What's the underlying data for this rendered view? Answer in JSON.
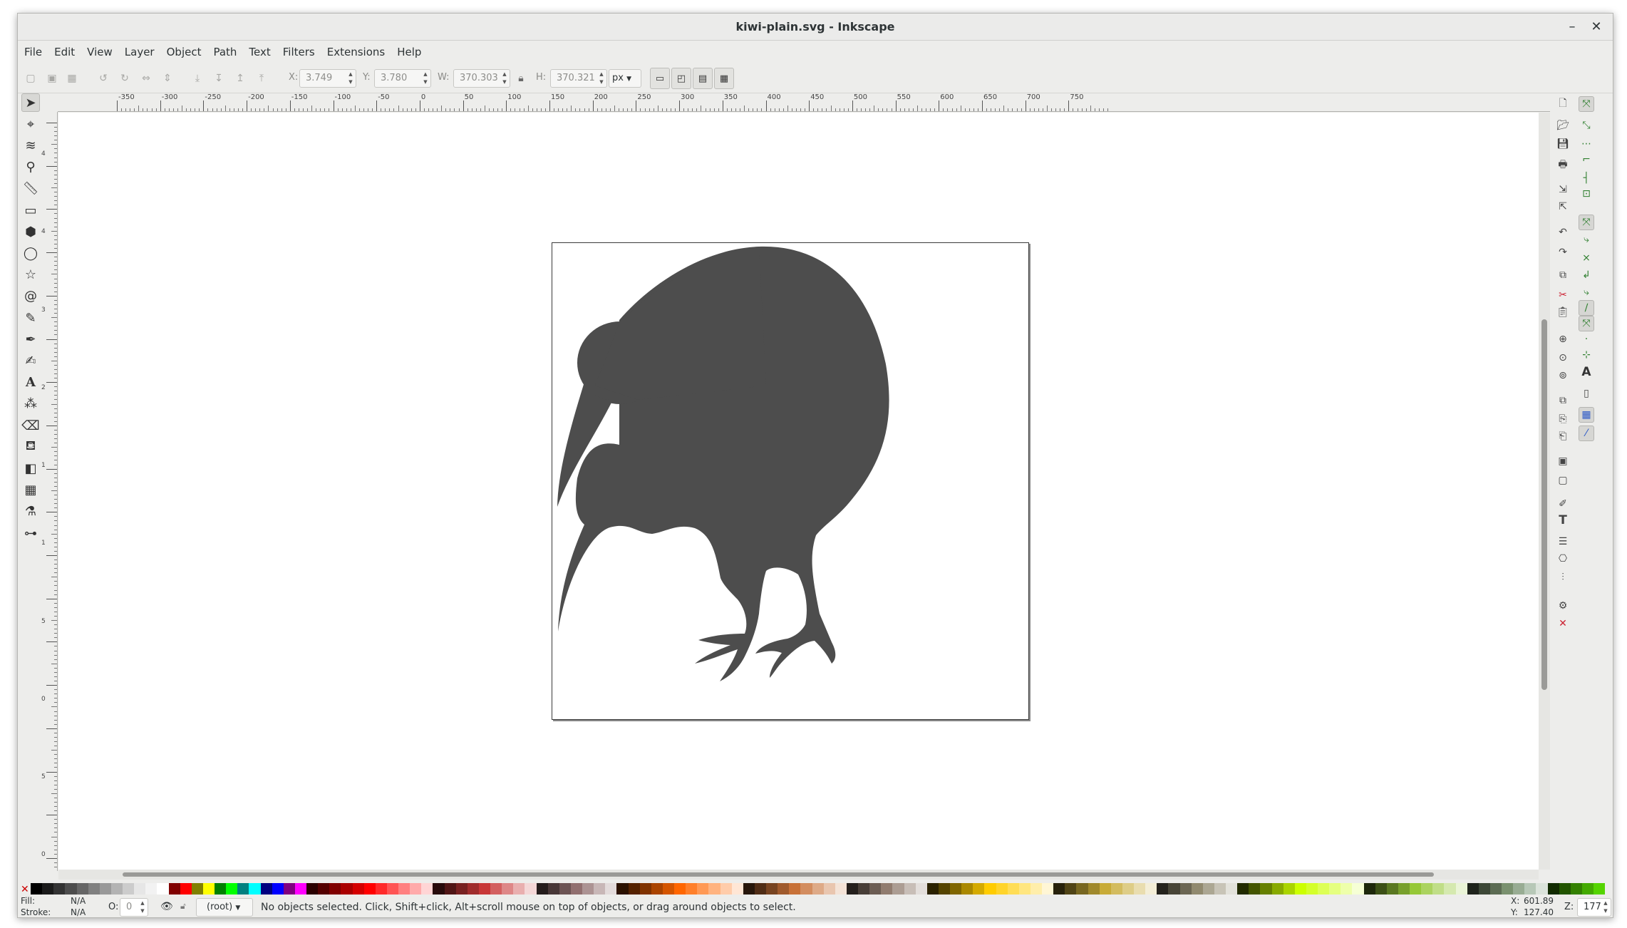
{
  "window": {
    "title": "kiwi-plain.svg - Inkscape",
    "minimize_glyph": "–",
    "close_glyph": "✕"
  },
  "menu": [
    "File",
    "Edit",
    "View",
    "Layer",
    "Object",
    "Path",
    "Text",
    "Filters",
    "Extensions",
    "Help"
  ],
  "tool_controls": {
    "x_label": "X:",
    "x_value": "3.749",
    "y_label": "Y:",
    "y_value": "3.780",
    "w_label": "W:",
    "w_value": "370.303",
    "h_label": "H:",
    "h_value": "370.321",
    "unit": "px"
  },
  "ruler": {
    "h_labels": [
      "-350",
      "-300",
      "-250",
      "-200",
      "-150",
      "-100",
      "-50",
      "0",
      "50",
      "100",
      "150",
      "200",
      "250",
      "300",
      "350",
      "400",
      "450",
      "500",
      "550",
      "600",
      "650",
      "700",
      "750"
    ],
    "v_labels": [
      "4",
      "4",
      "3",
      "2",
      "1",
      "1",
      "5",
      "0",
      "5",
      "0"
    ]
  },
  "toolbox": [
    "selector-tool-icon",
    "node-tool-icon",
    "tweak-tool-icon",
    "zoom-tool-icon",
    "measure-tool-icon",
    "rectangle-tool-icon",
    "3dbox-tool-icon",
    "ellipse-tool-icon",
    "star-tool-icon",
    "spiral-tool-icon",
    "pencil-tool-icon",
    "pen-tool-icon",
    "calligraphy-tool-icon",
    "text-tool-icon",
    "spray-tool-icon",
    "eraser-tool-icon",
    "paint-bucket-tool-icon",
    "gradient-tool-icon",
    "mesh-tool-icon",
    "dropper-tool-icon",
    "connector-tool-icon"
  ],
  "drawing": {
    "fill": "#4d4d4d",
    "page_border": "#3a3a3a"
  },
  "palette_colors": [
    "#000000",
    "#1a1a1a",
    "#333333",
    "#4d4d4d",
    "#666666",
    "#808080",
    "#999999",
    "#b3b3b3",
    "#cccccc",
    "#e6e6e6",
    "#f2f2f2",
    "#ffffff",
    "#800000",
    "#ff0000",
    "#808000",
    "#ffff00",
    "#008000",
    "#00ff00",
    "#008080",
    "#00ffff",
    "#000080",
    "#0000ff",
    "#800080",
    "#ff00ff",
    "#2b0000",
    "#550000",
    "#800000",
    "#aa0000",
    "#d40000",
    "#ff0000",
    "#ff2a2a",
    "#ff5555",
    "#ff8080",
    "#ffaaaa",
    "#ffd5d5",
    "#280b0b",
    "#501616",
    "#782121",
    "#a02c2c",
    "#c83737",
    "#d35f5f",
    "#de8787",
    "#e9afaf",
    "#f4d7d7",
    "#241c1c",
    "#483737",
    "#6c5353",
    "#916f6f",
    "#ac9393",
    "#c8b7b7",
    "#e3dbdb",
    "#2b1100",
    "#552200",
    "#803300",
    "#aa4400",
    "#d45500",
    "#ff6600",
    "#ff7f2a",
    "#ff9955",
    "#ffb380",
    "#ffccaa",
    "#ffe6d5",
    "#28170b",
    "#502d16",
    "#784421",
    "#a05a2c",
    "#c87137",
    "#d38d5f",
    "#deaa87",
    "#e9c6af",
    "#f4e3d7",
    "#241f1c",
    "#483e37",
    "#6c5d53",
    "#917c6f",
    "#ac9d93",
    "#c8beb7",
    "#e3dedb",
    "#2b2200",
    "#554400",
    "#806600",
    "#aa8800",
    "#d4aa00",
    "#ffcc00",
    "#ffd42a",
    "#ffdd55",
    "#ffe680",
    "#ffeeaa",
    "#fff6d5",
    "#28220b",
    "#504416",
    "#786721",
    "#a0892c",
    "#c8ab37",
    "#d3bc5f",
    "#decd87",
    "#e9ddaf",
    "#f4eed7",
    "#24221c",
    "#484537",
    "#6c6753",
    "#918a6f",
    "#aca793",
    "#c8c4b7",
    "#e3e2db",
    "#222b00",
    "#445500",
    "#668000",
    "#88aa00",
    "#aad400",
    "#ccff00",
    "#d4ff2a",
    "#ddff55",
    "#e5ff80",
    "#eeffaa",
    "#f6ffd5",
    "#1e280b",
    "#3c5016",
    "#5a7821",
    "#78a02c",
    "#96c837",
    "#abd35f",
    "#c0de87",
    "#d5e9af",
    "#eaf4d7",
    "#1f241c",
    "#3d4837",
    "#5c6c53",
    "#7a916f",
    "#98ac93",
    "#b7c8b7",
    "#dbe3db",
    "#112b00",
    "#225500",
    "#338000",
    "#44aa00",
    "#55d400"
  ],
  "status": {
    "fill_label": "Fill:",
    "fill_value": "N/A",
    "stroke_label": "Stroke:",
    "stroke_value": "N/A",
    "opacity_label": "O:",
    "opacity_value": "0",
    "layer": "(root)",
    "message": "No objects selected. Click, Shift+click, Alt+scroll mouse on top of objects, or drag around objects to select.",
    "cursor_x_label": "X:",
    "cursor_x": "601.89",
    "cursor_y_label": "Y:",
    "cursor_y": "127.40",
    "zoom_label": "Z:",
    "zoom_value": "177"
  }
}
